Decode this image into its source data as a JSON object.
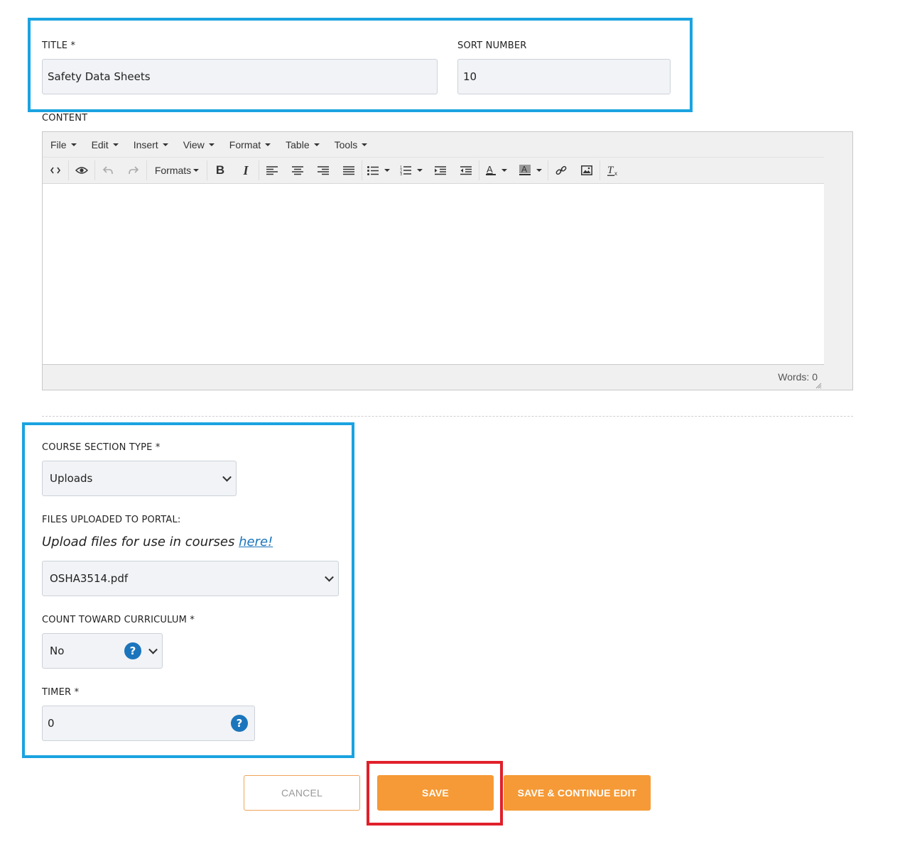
{
  "title_field": {
    "label": "TITLE *",
    "value": "Safety Data Sheets"
  },
  "sort_field": {
    "label": "SORT NUMBER",
    "value": "10"
  },
  "content": {
    "label": "CONTENT",
    "menu": [
      "File",
      "Edit",
      "Insert",
      "View",
      "Format",
      "Table",
      "Tools"
    ],
    "formats_label": "Formats",
    "word_count": "Words: 0",
    "toolbar_icons": [
      "source-code-icon",
      "preview-icon",
      "undo-icon",
      "redo-icon",
      "bold-icon",
      "italic-icon",
      "align-left-icon",
      "align-center-icon",
      "align-right-icon",
      "justify-icon",
      "bullet-list-icon",
      "numbered-list-icon",
      "indent-icon",
      "outdent-icon",
      "text-color-icon",
      "background-color-icon",
      "link-icon",
      "image-icon",
      "clear-formatting-icon"
    ]
  },
  "section_type": {
    "label": "COURSE SECTION TYPE *",
    "selected": "Uploads"
  },
  "files": {
    "label": "FILES UPLOADED TO PORTAL:",
    "hint_text": "Upload files for use in courses ",
    "hint_link": "here!",
    "selected": "OSHA3514.pdf"
  },
  "count_curriculum": {
    "label": "COUNT TOWARD CURRICULUM *",
    "selected": "No"
  },
  "timer": {
    "label": "TIMER *",
    "value": "0"
  },
  "buttons": {
    "cancel": "CANCEL",
    "save": "SAVE",
    "save_continue": "SAVE & CONTINUE EDIT"
  },
  "colors": {
    "highlight_blue": "#1aa3e0",
    "highlight_red": "#e0202a",
    "accent_orange": "#f59a36",
    "help_blue": "#1b75bc"
  }
}
